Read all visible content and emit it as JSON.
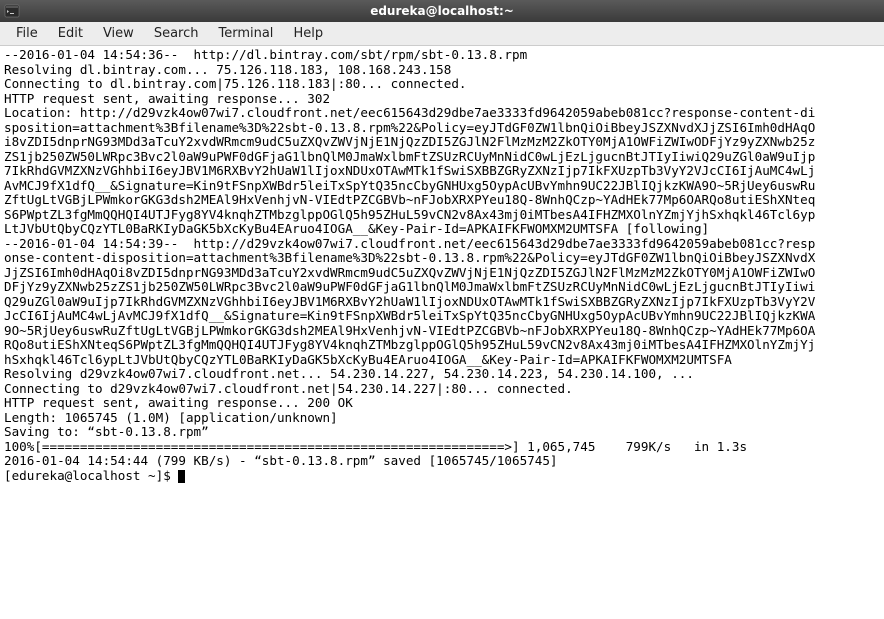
{
  "window": {
    "title": "edureka@localhost:~"
  },
  "menu": {
    "file": "File",
    "edit": "Edit",
    "view": "View",
    "search": "Search",
    "terminal": "Terminal",
    "help": "Help"
  },
  "terminal": {
    "lines": [
      "--2016-01-04 14:54:36--  http://dl.bintray.com/sbt/rpm/sbt-0.13.8.rpm",
      "Resolving dl.bintray.com... 75.126.118.183, 108.168.243.158",
      "Connecting to dl.bintray.com|75.126.118.183|:80... connected.",
      "HTTP request sent, awaiting response... 302 ",
      "Location: http://d29vzk4ow07wi7.cloudfront.net/eec615643d29dbe7ae3333fd9642059abeb081cc?response-content-di",
      "sposition=attachment%3Bfilename%3D%22sbt-0.13.8.rpm%22&Policy=eyJTdGF0ZW1lbnQiOiBbeyJSZXNvdXJjZSI6Imh0dHAqO",
      "i8vZDI5dnprNG93MDd3aTcuY2xvdWRmcm9udC5uZXQvZWVjNjE1NjQzZDI5ZGJlN2FlMzMzM2ZkOTY0MjA1OWFiZWIwODFjYz9yZXNwb25z",
      "ZS1jb250ZW50LWRpc3Bvc2l0aW9uPWF0dGFjaG1lbnQlM0JmaWxlbmFtZSUzRCUyMnNidC0wLjEzLjgucnBtJTIyIiwiQ29uZGl0aW9uIjp",
      "7IkRhdGVMZXNzVGhhbiI6eyJBV1M6RXBvY2hUaW1lIjoxNDUxOTAwMTk1fSwiSXBBZGRyZXNzIjp7IkFXUzpTb3VyY2VJcCI6IjAuMC4wLj",
      "AvMCJ9fX1dfQ__&Signature=Kin9tFSnpXWBdr5leiTxSpYtQ35ncCbyGNHUxg5OypAcUBvYmhn9UC22JBlIQjkzKWA9O~5RjUey6uswRu",
      "ZftUgLtVGBjLPWmkorGKG3dsh2MEAl9HxVenhjvN-VIEdtPZCGBVb~nFJobXRXPYeu18Q-8WnhQCzp~YAdHEk77Mp6OARQo8utiEShXNteq",
      "S6PWptZL3fgMmQQHQI4UTJFyg8YV4knqhZTMbzglppOGlQ5h95ZHuL59vCN2v8Ax43mj0iMTbesA4IFHZMXOlnYZmjYjhSxhqkl46Tcl6yp",
      "LtJVbUtQbyCQzYTL0BaRKIyDaGK5bXcKyBu4EAruo4IOGA__&Key-Pair-Id=APKAIFKFWOMXM2UMTSFA [following]",
      "--2016-01-04 14:54:39--  http://d29vzk4ow07wi7.cloudfront.net/eec615643d29dbe7ae3333fd9642059abeb081cc?resp",
      "onse-content-disposition=attachment%3Bfilename%3D%22sbt-0.13.8.rpm%22&Policy=eyJTdGF0ZW1lbnQiOiBbeyJSZXNvdX",
      "JjZSI6Imh0dHAqOi8vZDI5dnprNG93MDd3aTcuY2xvdWRmcm9udC5uZXQvZWVjNjE1NjQzZDI5ZGJlN2FlMzMzM2ZkOTY0MjA1OWFiZWIwO",
      "DFjYz9yZXNwb25zZS1jb250ZW50LWRpc3Bvc2l0aW9uPWF0dGFjaG1lbnQlM0JmaWxlbmFtZSUzRCUyMnNidC0wLjEzLjgucnBtJTIyIiwi",
      "Q29uZGl0aW9uIjp7IkRhdGVMZXNzVGhhbiI6eyJBV1M6RXBvY2hUaW1lIjoxNDUxOTAwMTk1fSwiSXBBZGRyZXNzIjp7IkFXUzpTb3VyY2V",
      "JcCI6IjAuMC4wLjAvMCJ9fX1dfQ__&Signature=Kin9tFSnpXWBdr5leiTxSpYtQ35ncCbyGNHUxg5OypAcUBvYmhn9UC22JBlIQjkzKWA",
      "9O~5RjUey6uswRuZftUgLtVGBjLPWmkorGKG3dsh2MEAl9HxVenhjvN-VIEdtPZCGBVb~nFJobXRXPYeu18Q-8WnhQCzp~YAdHEk77Mp6OA",
      "RQo8utiEShXNteqS6PWptZL3fgMmQQHQI4UTJFyg8YV4knqhZTMbzglppOGlQ5h95ZHuL59vCN2v8Ax43mj0iMTbesA4IFHZMXOlnYZmjYj",
      "hSxhqkl46Tcl6ypLtJVbUtQbyCQzYTL0BaRKIyDaGK5bXcKyBu4EAruo4IOGA__&Key-Pair-Id=APKAIFKFWOMXM2UMTSFA",
      "Resolving d29vzk4ow07wi7.cloudfront.net... 54.230.14.227, 54.230.14.223, 54.230.14.100, ...",
      "Connecting to d29vzk4ow07wi7.cloudfront.net|54.230.14.227|:80... connected.",
      "HTTP request sent, awaiting response... 200 OK",
      "Length: 1065745 (1.0M) [application/unknown]",
      "Saving to: “sbt-0.13.8.rpm”",
      "",
      "100%[=============================================================>] 1,065,745    799K/s   in 1.3s    ",
      "",
      "2016-01-04 14:54:44 (799 KB/s) - “sbt-0.13.8.rpm” saved [1065745/1065745]",
      "",
      "[edureka@localhost ~]$ "
    ]
  }
}
